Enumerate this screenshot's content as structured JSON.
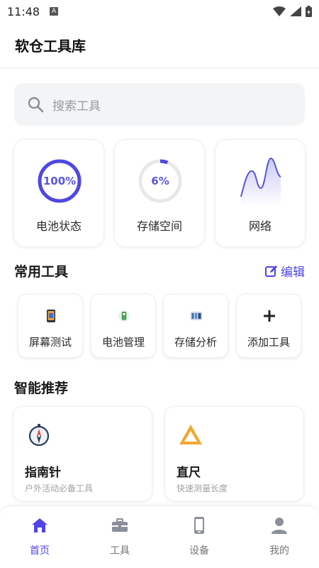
{
  "status": {
    "time": "11:48",
    "notif": "A"
  },
  "header": {
    "title": "软仓工具库"
  },
  "search": {
    "placeholder": "搜索工具"
  },
  "stats": {
    "battery": {
      "label": "电池状态",
      "value": "100%",
      "percent": 100
    },
    "storage": {
      "label": "存储空间",
      "value": "6%",
      "percent": 6
    },
    "network": {
      "label": "网络"
    }
  },
  "common_tools": {
    "title": "常用工具",
    "edit_label": "编辑",
    "items": [
      {
        "label": "屏幕测试",
        "icon": "phone-screen-icon"
      },
      {
        "label": "电池管理",
        "icon": "battery-icon"
      },
      {
        "label": "存储分析",
        "icon": "storage-icon"
      },
      {
        "label": "添加工具",
        "icon": "plus-icon"
      }
    ]
  },
  "recommend": {
    "title": "智能推荐",
    "items": [
      {
        "title": "指南针",
        "subtitle": "户外活动必备工具",
        "icon": "compass-icon"
      },
      {
        "title": "直尺",
        "subtitle": "快速测量长度",
        "icon": "ruler-icon"
      }
    ]
  },
  "bottom_nav": {
    "items": [
      {
        "label": "首页",
        "icon": "home-icon",
        "active": true
      },
      {
        "label": "工具",
        "icon": "toolbox-icon",
        "active": false
      },
      {
        "label": "设备",
        "icon": "device-icon",
        "active": false
      },
      {
        "label": "我的",
        "icon": "user-icon",
        "active": false
      }
    ]
  },
  "colors": {
    "accent": "#4f46e5",
    "ring_track": "#e8e8ec",
    "page_bg": "#ffffff"
  }
}
